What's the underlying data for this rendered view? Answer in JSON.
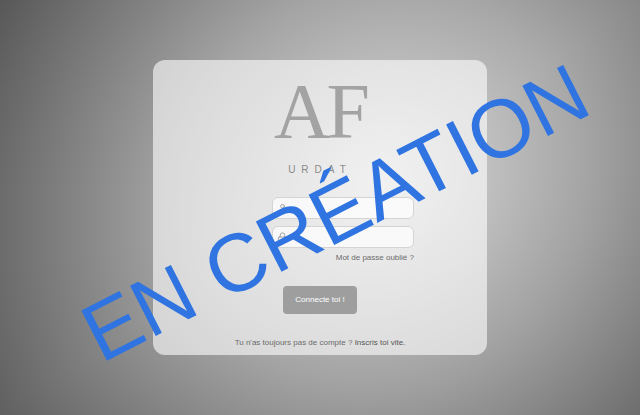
{
  "logo": {
    "monogram": "AF",
    "subtitle": "URDAT"
  },
  "form": {
    "fields": [
      {
        "kind": "user"
      },
      {
        "kind": "password"
      }
    ],
    "forgot_link": "Mot de passe oublié ?",
    "submit": "Connecte toi !"
  },
  "signup": {
    "prompt": "Tu n'as toujours pas de compte ?",
    "link": "Inscris toi vite."
  },
  "watermark": "EN CRÉATION"
}
